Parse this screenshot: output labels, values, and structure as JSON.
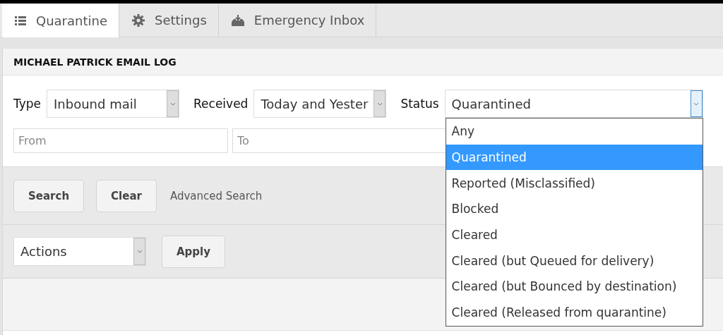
{
  "tabs": [
    {
      "label": "Quarantine",
      "selected": true
    },
    {
      "label": "Settings",
      "selected": false
    },
    {
      "label": "Emergency Inbox",
      "selected": false
    }
  ],
  "panel": {
    "title": "MICHAEL PATRICK EMAIL LOG",
    "filters": [
      {
        "label": "Type",
        "value": "Inbound mail",
        "expanded": false
      },
      {
        "label": "Received",
        "value": "Today and Yester",
        "expanded": false
      },
      {
        "label": "Status",
        "value": "Quarantined",
        "expanded": true,
        "options": [
          {
            "label": "Any",
            "selected": false
          },
          {
            "label": "Quarantined",
            "selected": true
          },
          {
            "label": "Reported (Misclassified)",
            "selected": false
          },
          {
            "label": "Blocked",
            "selected": false
          },
          {
            "label": "Cleared",
            "selected": false
          },
          {
            "label": "Cleared (but Queued for delivery)",
            "selected": false
          },
          {
            "label": "Cleared (but Bounced by destination)",
            "selected": false
          },
          {
            "label": "Cleared (Released from quarantine)",
            "selected": false
          }
        ]
      }
    ],
    "text_fields": [
      {
        "placeholder": "From"
      },
      {
        "placeholder": "To"
      }
    ],
    "buttons": [
      "Search",
      "Clear"
    ],
    "link": "Advanced Search",
    "actions": {
      "value": "Actions",
      "button": "Apply"
    }
  }
}
